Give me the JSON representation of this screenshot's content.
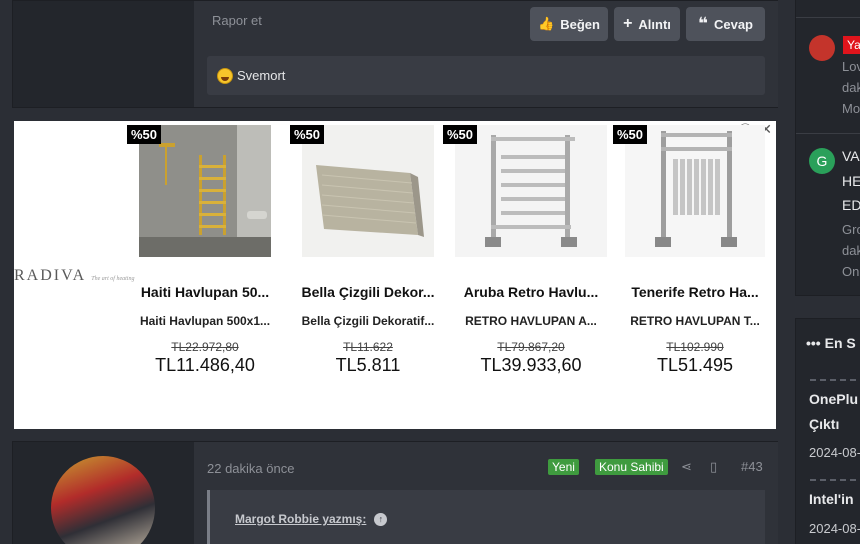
{
  "post1": {
    "report": "Rapor et",
    "like": "Beğen",
    "quote_add": "Alıntı",
    "reply": "Cevap",
    "reaction_user": "Svemort"
  },
  "ad": {
    "brand": "RADIVA",
    "brand_sub": "The art of heating",
    "products": [
      {
        "badge": "%50",
        "title": "Haiti Havlupan 50...",
        "subtitle": "Haiti Havlupan 500x1...",
        "old_price": "TL22.972,80",
        "price": "TL11.486,40"
      },
      {
        "badge": "%50",
        "title": "Bella Çizgili Dekor...",
        "subtitle": "Bella Çizgili Dekoratif...",
        "old_price": "TL11.622",
        "price": "TL5.811"
      },
      {
        "badge": "%50",
        "title": "Aruba Retro Havlu...",
        "subtitle": "RETRO HAVLUPAN A...",
        "old_price": "TL79.867,20",
        "price": "TL39.933,60"
      },
      {
        "badge": "%50",
        "title": "Tenerife Retro Ha...",
        "subtitle": "RETRO HAVLUPAN T...",
        "old_price": "TL102.990",
        "price": "TL51.495"
      }
    ]
  },
  "post2": {
    "time": "22 dakika önce",
    "tag_new": "Yeni",
    "tag_owner": "Konu Sahibi",
    "post_number": "#43",
    "quote_author": "Margot Robbie yazmış:"
  },
  "right": {
    "item1_badge": "Ya",
    "item1_lines": [
      "Lov",
      "dak",
      "Mo"
    ],
    "item2_letter": "G",
    "item2_lines": [
      "VA",
      "HE",
      "ED"
    ],
    "item2_meta": [
      "Gro",
      "dak",
      "Onl"
    ],
    "section_title": "En S",
    "news1_title": [
      "OnePlu",
      "Çıktı"
    ],
    "news1_date": "2024-08-",
    "news2_title": "Intel'in",
    "news2_date": "2024-08-"
  },
  "colors": {
    "tag_green": "#3f9b3f",
    "badge_red": "#e0141c",
    "avatar_green": "#2aa05a"
  }
}
